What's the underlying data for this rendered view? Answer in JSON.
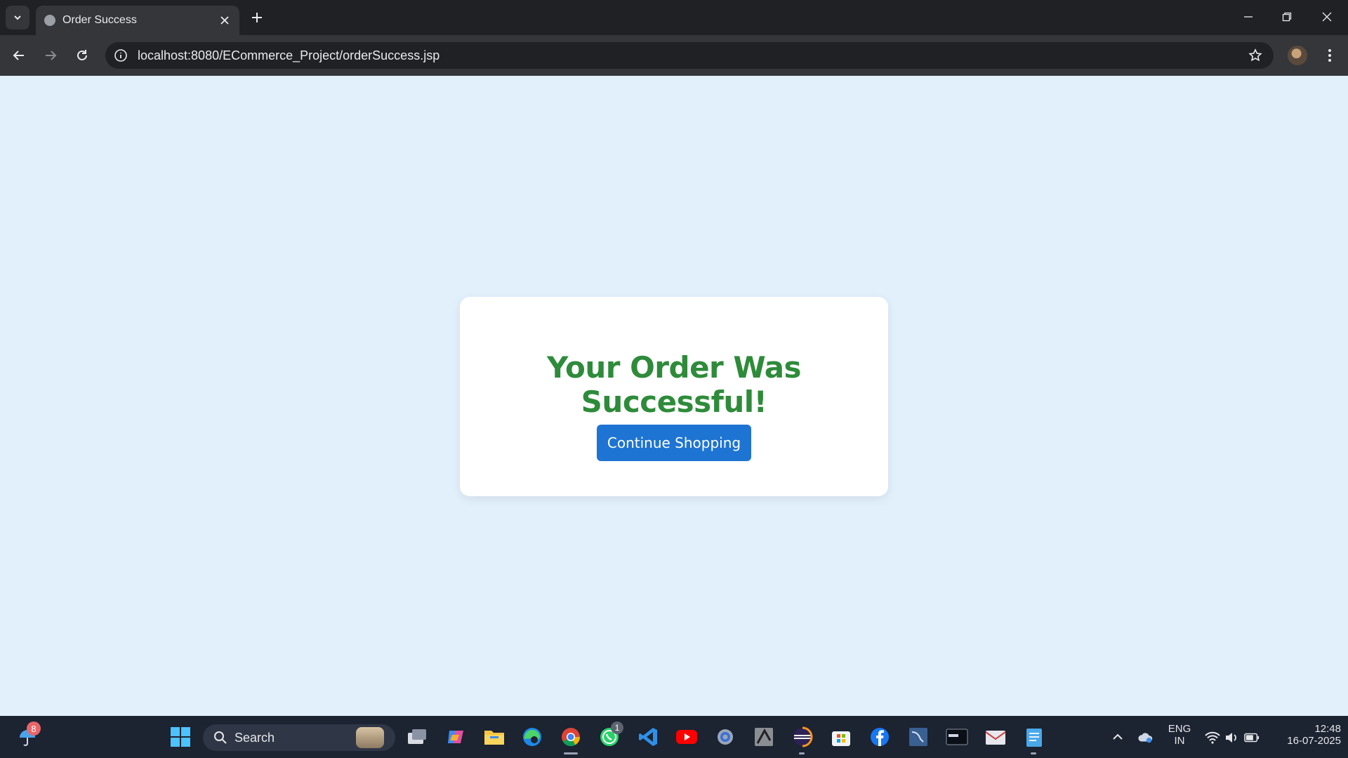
{
  "browser": {
    "tab_title": "Order Success",
    "url": "localhost:8080/ECommerce_Project/orderSuccess.jsp"
  },
  "page": {
    "heading": "Your Order Was Successful!",
    "continue_label": "Continue Shopping",
    "colors": {
      "background": "#e2f0fc",
      "heading": "#2e8b3a",
      "button": "#1e74d2"
    }
  },
  "taskbar": {
    "weather_badge": "8",
    "search_placeholder": "Search",
    "whatsapp_badge": "1",
    "pinned_apps": [
      "task-view",
      "copilot",
      "file-explorer",
      "edge",
      "chrome",
      "whatsapp",
      "vscode",
      "youtube",
      "settings",
      "app-icon",
      "eclipse",
      "microsoft-store",
      "facebook",
      "mysql-workbench",
      "mysql-cli",
      "mail",
      "notepad"
    ]
  },
  "tray": {
    "language": "ENG",
    "region": "IN",
    "time": "12:48",
    "date": "16-07-2025"
  }
}
